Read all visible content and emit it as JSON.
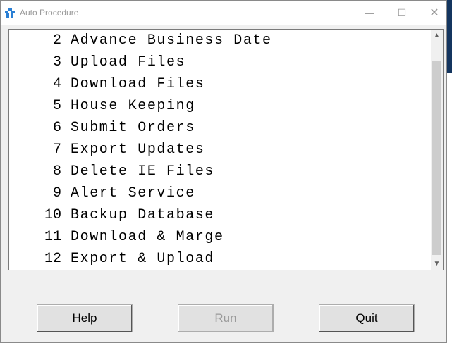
{
  "window": {
    "title": "Auto Procedure",
    "controls": {
      "minimize": "—",
      "maximize": "☐",
      "close": "✕"
    }
  },
  "list": {
    "items": [
      {
        "num": "2",
        "label": "Advance Business Date"
      },
      {
        "num": "3",
        "label": "Upload Files"
      },
      {
        "num": "4",
        "label": "Download Files"
      },
      {
        "num": "5",
        "label": "House Keeping"
      },
      {
        "num": "6",
        "label": "Submit Orders"
      },
      {
        "num": "7",
        "label": "Export Updates"
      },
      {
        "num": "8",
        "label": "Delete IE Files"
      },
      {
        "num": "9",
        "label": "Alert Service"
      },
      {
        "num": "10",
        "label": "Backup Database"
      },
      {
        "num": "11",
        "label": "Download & Marge"
      },
      {
        "num": "12",
        "label": "Export & Upload"
      }
    ],
    "scroll_up_icon": "▲",
    "scroll_down_icon": "▼"
  },
  "buttons": {
    "help": "Help",
    "run": "Run",
    "quit": "Quit"
  },
  "colors": {
    "window_bg": "#f0f0f0",
    "title_text": "#9a9a9a",
    "disabled_text": "#9a9a9a"
  }
}
